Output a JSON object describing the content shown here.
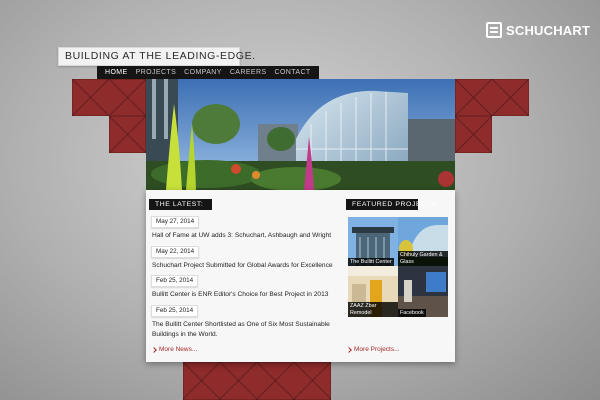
{
  "brand": {
    "name": "SCHUCHART"
  },
  "tagline": "BUILDING AT THE LEADING-EDGE.",
  "nav": {
    "items": [
      "HOME",
      "PROJECTS",
      "COMPANY",
      "CAREERS",
      "CONTACT"
    ],
    "active": "HOME"
  },
  "latest": {
    "heading": "THE LATEST:",
    "items": [
      {
        "date": "May 27, 2014",
        "title": "Hall of Fame at UW adds 3: Schuchart, Ashbaugh and Wright"
      },
      {
        "date": "May 22, 2014",
        "title": "Schuchart Project Submitted for Global Awards for Excellence"
      },
      {
        "date": "Feb 25, 2014",
        "title": "Bullitt Center is ENR Editor's Choice for Best Project in 2013"
      },
      {
        "date": "Feb 25, 2014",
        "title": "The Bullitt Center Shortlisted as One of Six Most Sustainable Buildings in the World."
      }
    ],
    "more_label": "More News..."
  },
  "featured": {
    "heading": "FEATURED PROJECTS:",
    "items": [
      {
        "label": "The Bullitt Center"
      },
      {
        "label": "Chihuly Garden & Glass"
      },
      {
        "label": "ZAAZ Zbar Remodel"
      },
      {
        "label": "Facebook"
      }
    ],
    "more_label": "More Projects..."
  },
  "colors": {
    "accent": "#8e2b2b",
    "nav_bg": "#151515",
    "link": "#a52a2a"
  }
}
